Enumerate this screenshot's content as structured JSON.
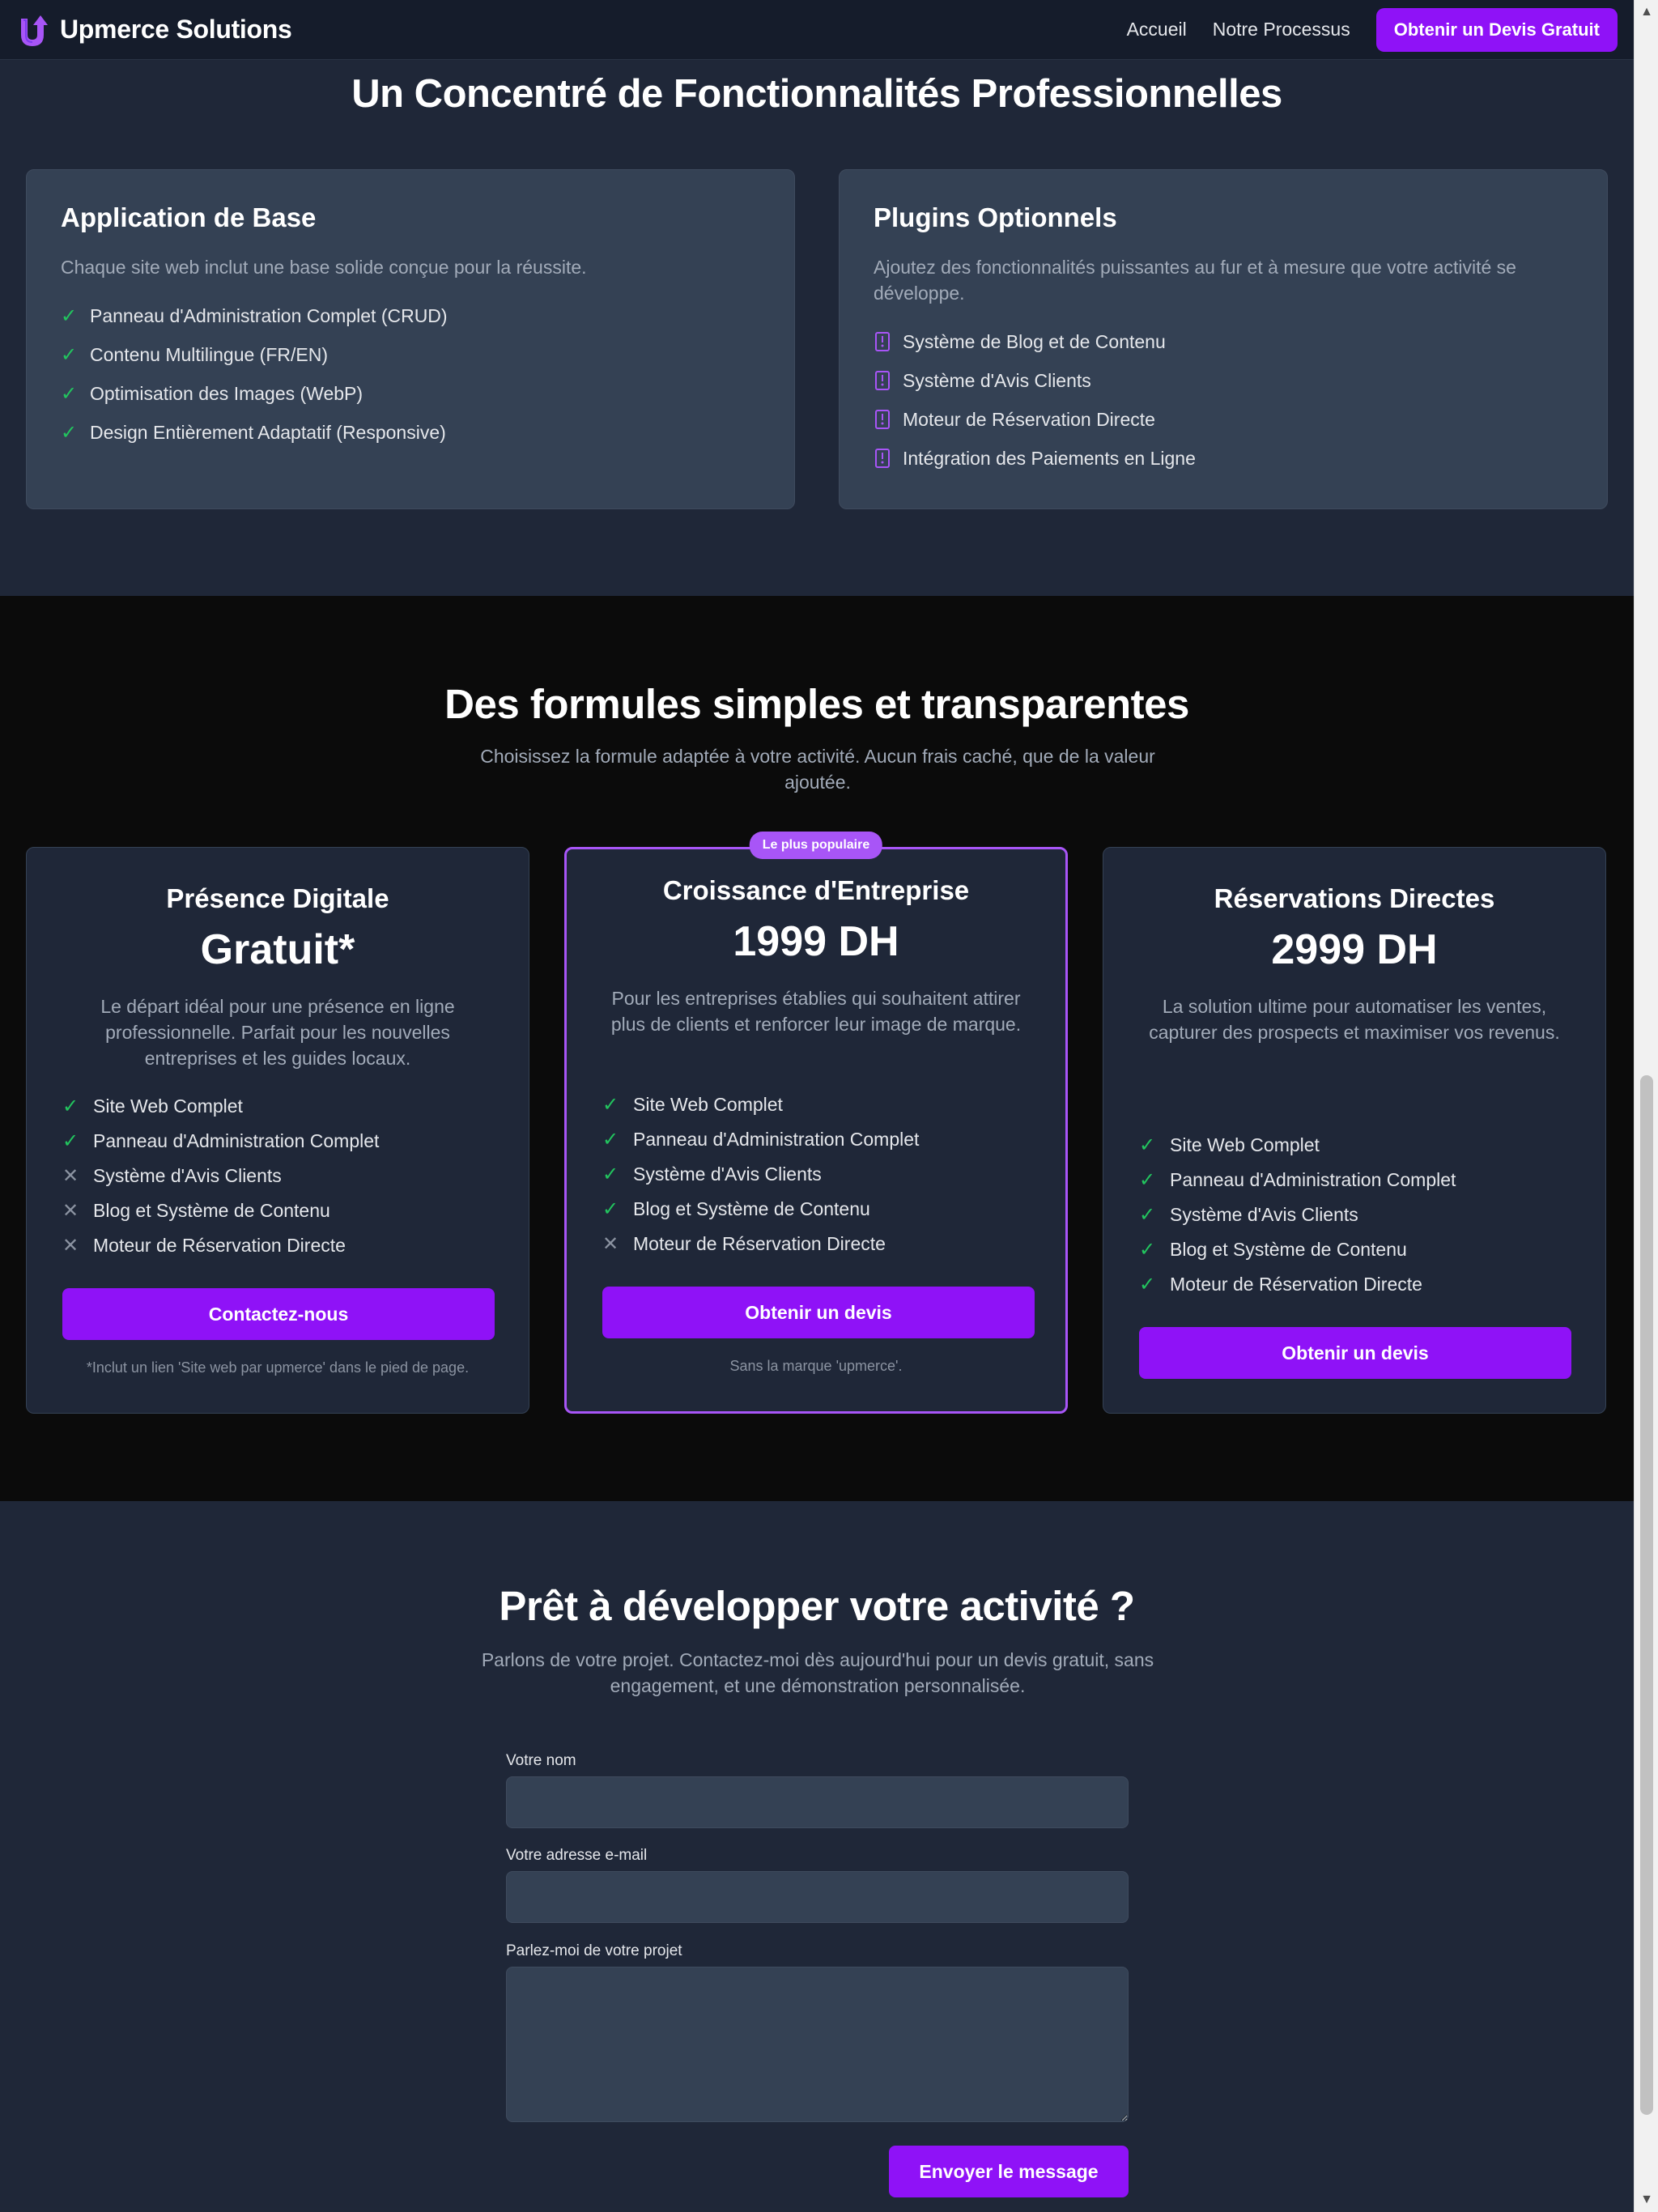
{
  "header": {
    "brand": "Upmerce Solutions",
    "nav": [
      "Accueil",
      "Notre Processus"
    ],
    "cta": "Obtenir un Devis Gratuit"
  },
  "features": {
    "title": "Un Concentré de Fonctionnalités Professionnelles",
    "cards": [
      {
        "title": "Application de Base",
        "desc": "Chaque site web inclut une base solide conçue pour la réussite.",
        "icon": "check-icon",
        "items": [
          "Panneau d'Administration Complet (CRUD)",
          "Contenu Multilingue (FR/EN)",
          "Optimisation des Images (WebP)",
          "Design Entièrement Adaptatif (Responsive)"
        ]
      },
      {
        "title": "Plugins Optionnels",
        "desc": "Ajoutez des fonctionnalités puissantes au fur et à mesure que votre activité se développe.",
        "icon": "plugin-icon",
        "items": [
          "Système de Blog et de Contenu",
          "Système d'Avis Clients",
          "Moteur de Réservation Directe",
          "Intégration des Paiements en Ligne"
        ]
      }
    ]
  },
  "pricing": {
    "title": "Des formules simples et transparentes",
    "subtitle": "Choisissez la formule adaptée à votre activité. Aucun frais caché, que de la valeur ajoutée.",
    "plans": [
      {
        "name": "Présence Digitale",
        "price": "Gratuit*",
        "desc": "Le départ idéal pour une présence en ligne professionnelle. Parfait pour les nouvelles entreprises et les guides locaux.",
        "features": [
          {
            "label": "Site Web Complet",
            "included": true
          },
          {
            "label": "Panneau d'Administration Complet",
            "included": true
          },
          {
            "label": "Système d'Avis Clients",
            "included": false
          },
          {
            "label": "Blog et Système de Contenu",
            "included": false
          },
          {
            "label": "Moteur de Réservation Directe",
            "included": false
          }
        ],
        "button": "Contactez-nous",
        "note": "*Inclut un lien 'Site web par upmerce' dans le pied de page."
      },
      {
        "name": "Croissance d'Entreprise",
        "price": "1999 DH",
        "badge": "Le plus populaire",
        "desc": "Pour les entreprises établies qui souhaitent attirer plus de clients et renforcer leur image de marque.",
        "features": [
          {
            "label": "Site Web Complet",
            "included": true
          },
          {
            "label": "Panneau d'Administration Complet",
            "included": true
          },
          {
            "label": "Système d'Avis Clients",
            "included": true
          },
          {
            "label": "Blog et Système de Contenu",
            "included": true
          },
          {
            "label": "Moteur de Réservation Directe",
            "included": false
          }
        ],
        "button": "Obtenir un devis",
        "note": "Sans la marque 'upmerce'."
      },
      {
        "name": "Réservations Directes",
        "price": "2999 DH",
        "desc": "La solution ultime pour automatiser les ventes, capturer des prospects et maximiser vos revenus.",
        "features": [
          {
            "label": "Site Web Complet",
            "included": true
          },
          {
            "label": "Panneau d'Administration Complet",
            "included": true
          },
          {
            "label": "Système d'Avis Clients",
            "included": true
          },
          {
            "label": "Blog et Système de Contenu",
            "included": true
          },
          {
            "label": "Moteur de Réservation Directe",
            "included": true
          }
        ],
        "button": "Obtenir un devis"
      }
    ]
  },
  "contact": {
    "title": "Prêt à développer votre activité ?",
    "subtitle": "Parlons de votre projet. Contactez-moi dès aujourd'hui pour un devis gratuit, sans engagement, et une démonstration personnalisée.",
    "name_label": "Votre nom",
    "name_value": "",
    "email_label": "Votre adresse e-mail",
    "email_value": "",
    "message_label": "Parlez-moi de votre projet",
    "message_value": "",
    "submit": "Envoyer le message"
  },
  "colors": {
    "accent": "#8f12f7",
    "badge": "#a855f7",
    "check": "#22c55e",
    "cross": "#8b93a1"
  }
}
